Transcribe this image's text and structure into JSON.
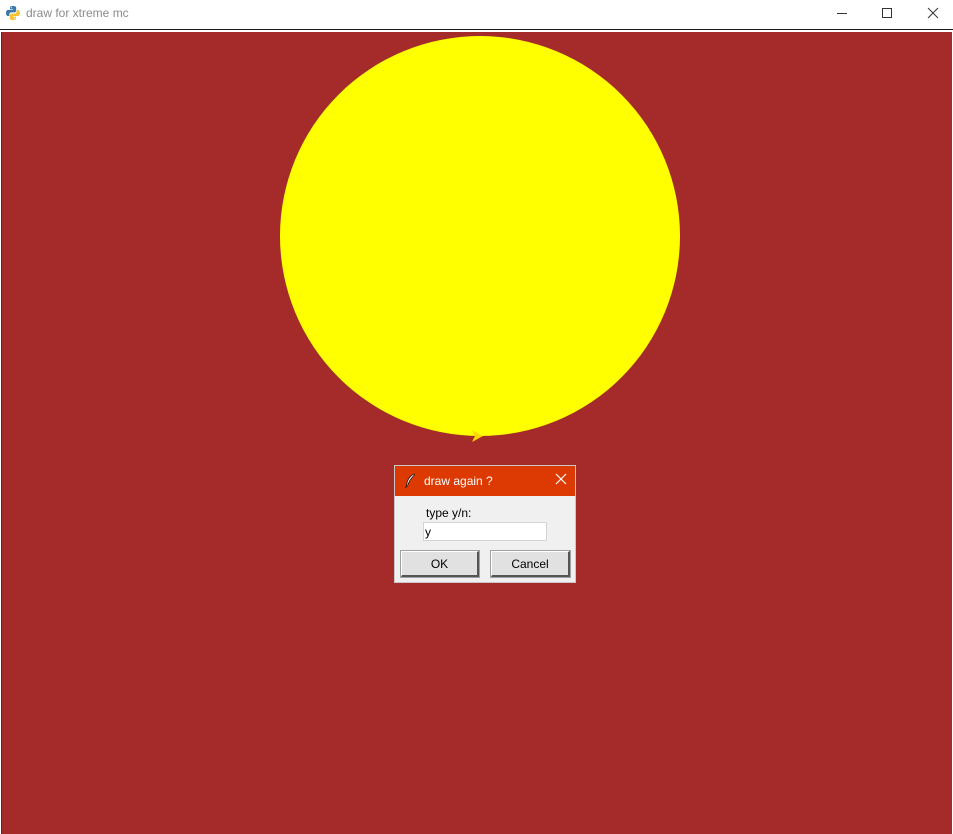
{
  "window": {
    "title": "draw for xtreme mc",
    "icon": "python-icon",
    "controls": {
      "minimize_icon": "minimize-icon",
      "maximize_icon": "maximize-icon",
      "close_icon": "close-icon"
    }
  },
  "canvas": {
    "background_color": "#a52a2a",
    "circle_color": "#ffff00",
    "turtle_color": "#ffd700"
  },
  "dialog": {
    "title": "draw again ?",
    "title_bar_color": "#dc3a02",
    "icon": "feather-icon",
    "prompt": "type y/n:",
    "input_value": "y",
    "ok_label": "OK",
    "cancel_label": "Cancel"
  }
}
